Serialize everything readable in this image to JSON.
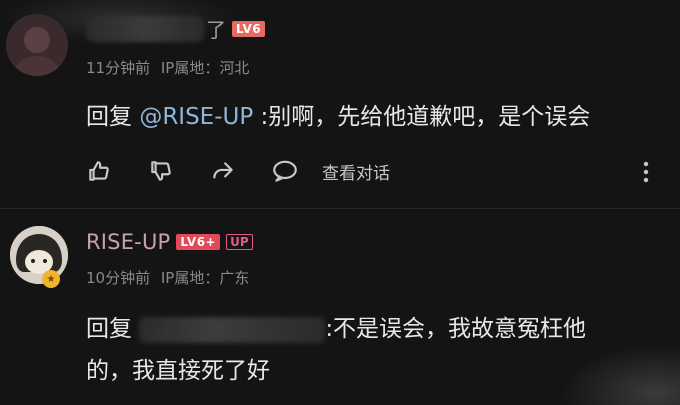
{
  "comment1": {
    "name_tail": "了",
    "level": "LV6",
    "time": "11分钟前",
    "ip": "IP属地：河北",
    "reply_prefix": "回复 ",
    "mention": "@RISE-UP",
    "reply_text": " :别啊，先给他道歉吧，是个误会",
    "view_conversation": "查看对话"
  },
  "comment2": {
    "username": "RISE-UP",
    "level": "LV6+",
    "up_badge": "UP",
    "time": "10分钟前",
    "ip": "IP属地：广东",
    "reply_prefix": "回复 ",
    "reply_text_1": ":不是误会，我故意冤枉他",
    "reply_text_2": "的，我直接死了好"
  },
  "colors": {
    "background": "#141414",
    "username": "#c9a3a8",
    "mention": "#8fb5d8",
    "level_badge": "#e46a63",
    "up_badge": "#e05b88"
  },
  "icons": [
    "like-icon",
    "dislike-icon",
    "share-icon",
    "comment-icon",
    "more-icon"
  ]
}
